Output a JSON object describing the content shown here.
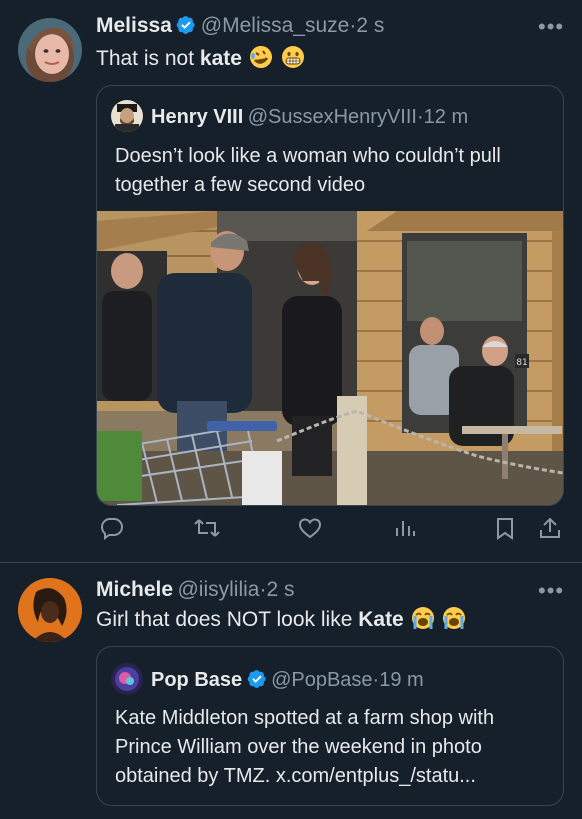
{
  "tweet1": {
    "author_name": "Melissa",
    "handle": "@Melissa_suze",
    "time": "2 s",
    "text_prefix": "That is not ",
    "text_bold": "kate",
    "quote": {
      "author_name": "Henry VIII",
      "handle": "@SussexHenryVIII",
      "time": "12 m",
      "text": "Doesn’t look like a woman who couldn’t pull together a few second video"
    }
  },
  "tweet2": {
    "author_name": "Michele",
    "handle": "@iisylilia",
    "time": "2 s",
    "text_prefix": "Girl that does NOT look like ",
    "text_bold": "Kate",
    "quote": {
      "author_name": "Pop Base",
      "handle": "@PopBase",
      "time": "19 m",
      "text": "Kate Middleton spotted at a farm shop with Prince William over the weekend in photo obtained by TMZ. x.com/entplus_/statu..."
    }
  },
  "separator": "·",
  "more_label": "•••",
  "photo_sign_text": "81",
  "colors": {
    "background": "#15202b",
    "verified": "#1d9bf0",
    "secondary": "#8b98a5",
    "border": "#38444d"
  },
  "icons": [
    "reply-icon",
    "retweet-icon",
    "like-icon",
    "views-icon",
    "bookmark-icon",
    "share-icon",
    "verified-badge-icon",
    "more-options-icon"
  ]
}
